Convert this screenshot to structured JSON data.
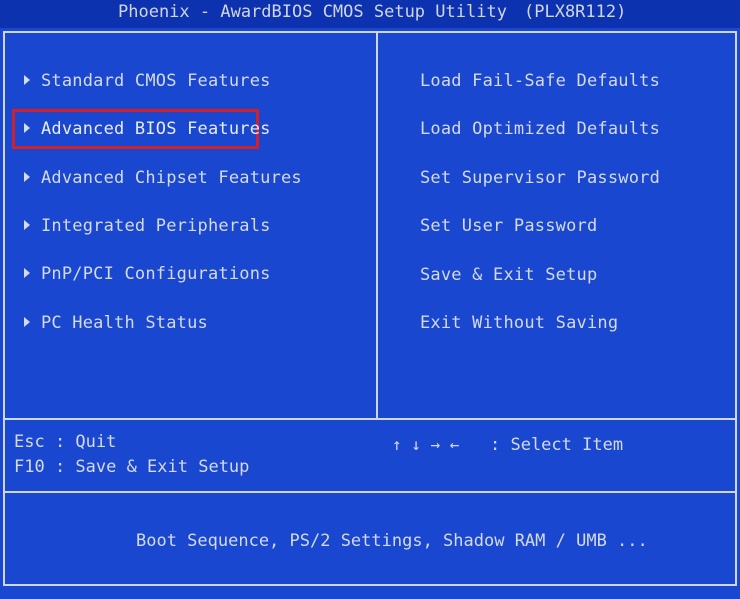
{
  "title": {
    "app": "Phoenix - AwardBIOS CMOS Setup Utility",
    "version": "(PLX8R112)"
  },
  "left_menu": [
    {
      "label": "Standard CMOS Features"
    },
    {
      "label": "Advanced BIOS Features"
    },
    {
      "label": "Advanced Chipset Features"
    },
    {
      "label": "Integrated Peripherals"
    },
    {
      "label": "PnP/PCI Configurations"
    },
    {
      "label": "PC Health Status"
    }
  ],
  "right_menu": [
    {
      "label": "Load Fail-Safe Defaults"
    },
    {
      "label": "Load Optimized Defaults"
    },
    {
      "label": "Set Supervisor Password"
    },
    {
      "label": "Set User Password"
    },
    {
      "label": "Save & Exit Setup"
    },
    {
      "label": "Exit Without Saving"
    }
  ],
  "selected_item": "Advanced BIOS Features",
  "help": {
    "esc": "Esc : Quit",
    "f10": "F10 : Save & Exit Setup",
    "arrows": "↑ ↓ → ←",
    "select": ": Select Item"
  },
  "status_text": "Boot Sequence, PS/2 Settings, Shadow RAM / UMB ...",
  "colors": {
    "background": "#1a47d0",
    "text": "#d4dae8",
    "highlight_border": "#d2202a"
  }
}
